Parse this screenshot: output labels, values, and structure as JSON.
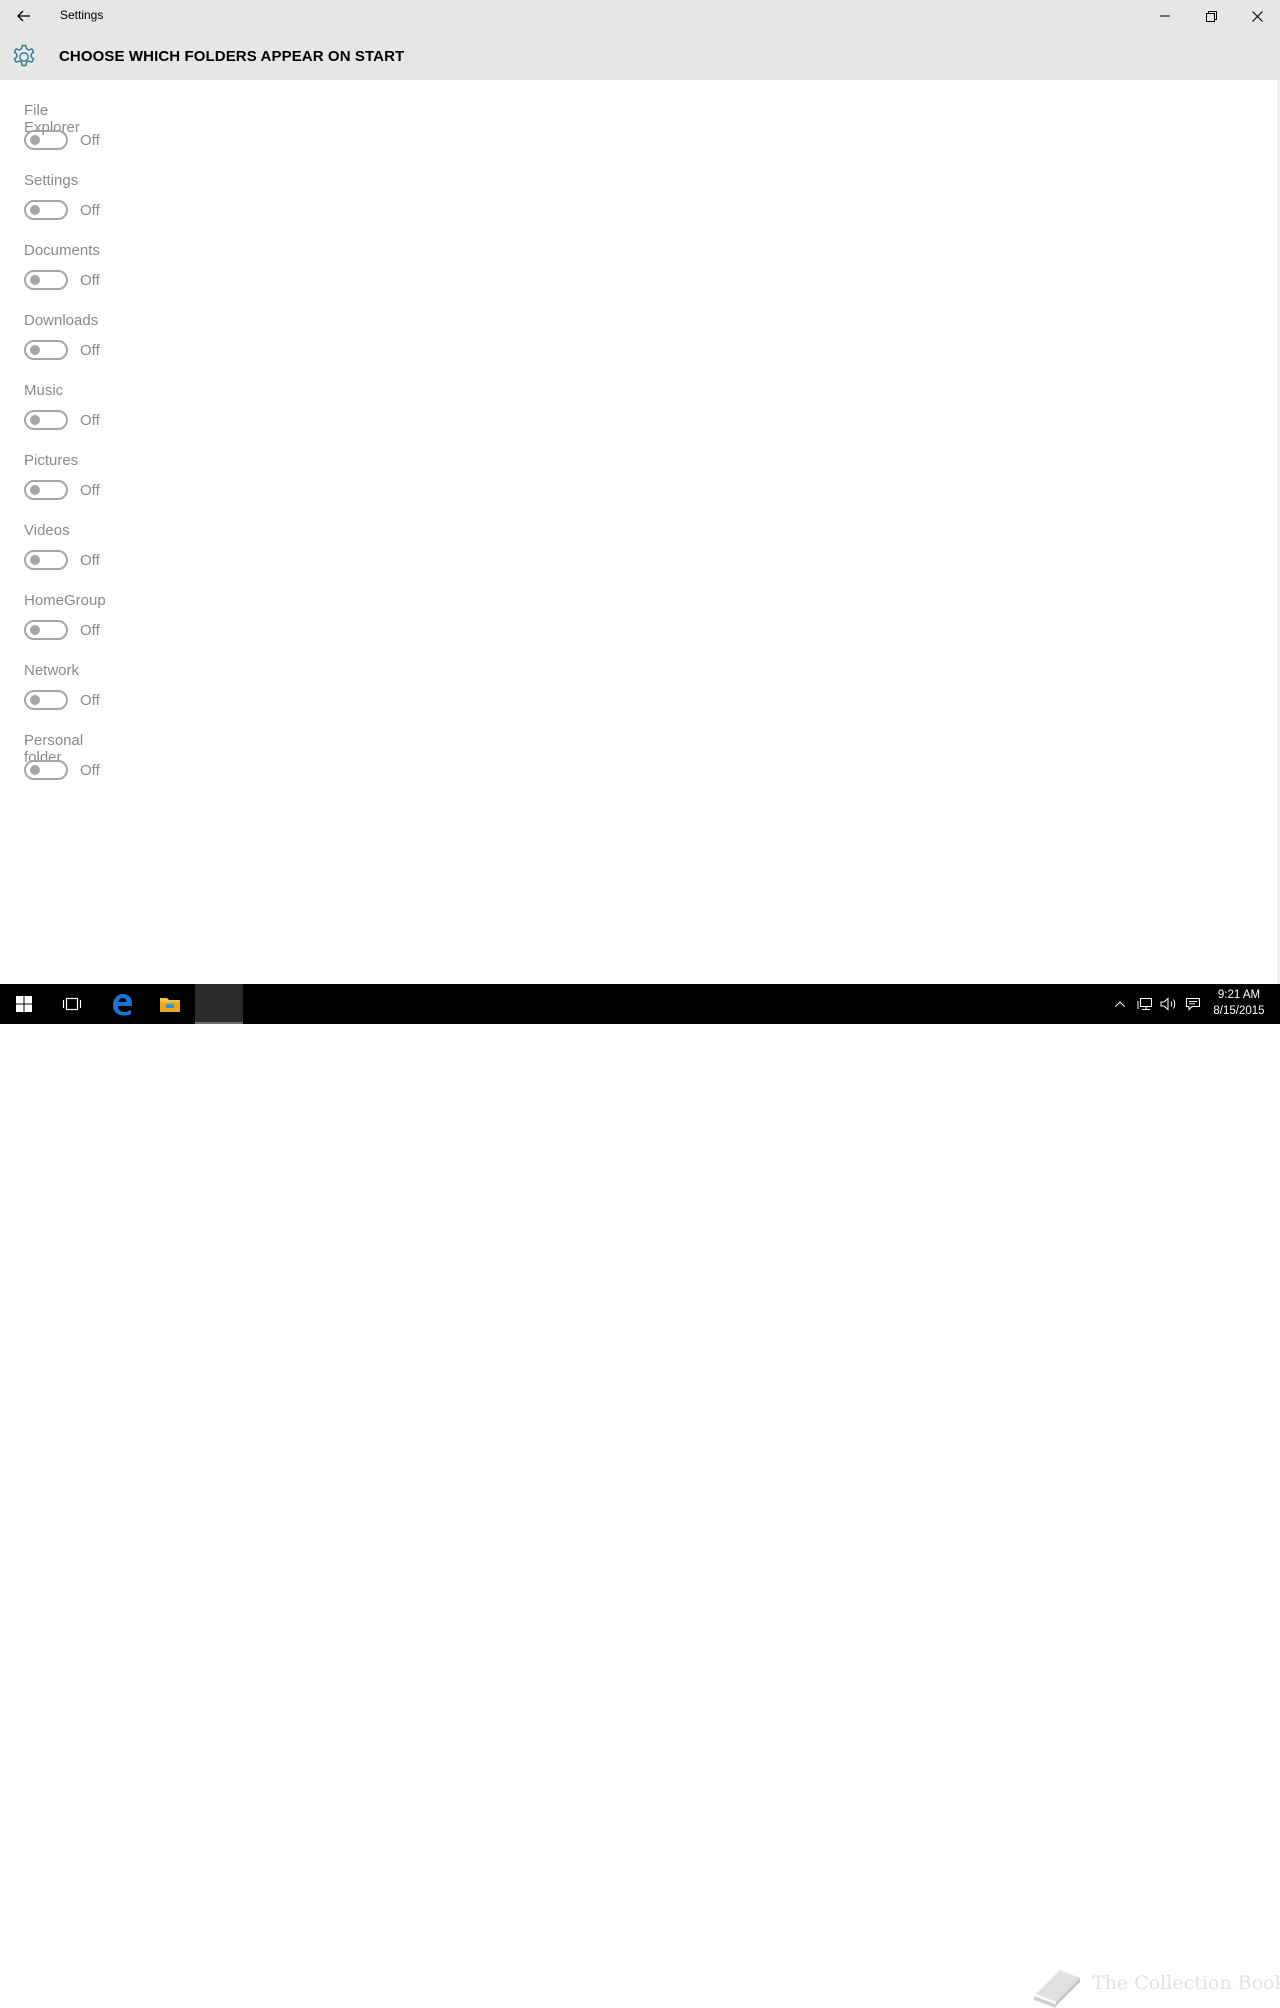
{
  "window": {
    "title": "Settings",
    "controls": {
      "minimize": "minimize-icon",
      "restore": "restore-icon",
      "close": "close-icon"
    }
  },
  "header": {
    "icon": "gear-icon",
    "title": "CHOOSE WHICH FOLDERS APPEAR ON START"
  },
  "settings": [
    {
      "label": "File Explorer",
      "state": "Off"
    },
    {
      "label": "Settings",
      "state": "Off"
    },
    {
      "label": "Documents",
      "state": "Off"
    },
    {
      "label": "Downloads",
      "state": "Off"
    },
    {
      "label": "Music",
      "state": "Off"
    },
    {
      "label": "Pictures",
      "state": "Off"
    },
    {
      "label": "Videos",
      "state": "Off"
    },
    {
      "label": "HomeGroup",
      "state": "Off"
    },
    {
      "label": "Network",
      "state": "Off"
    },
    {
      "label": "Personal folder",
      "state": "Off"
    }
  ],
  "taskbar": {
    "time": "9:21 AM",
    "date": "8/15/2015",
    "watermark": "The Collection Book"
  },
  "colors": {
    "accent": "#2d7d9a",
    "chrome": "#e6e6e6",
    "label": "#8a8a8a",
    "toggle_off": "#a6a6a6",
    "taskbar": "#000000",
    "edge_blue": "#1a75d2",
    "explorer_yellow": "#f4c542"
  }
}
